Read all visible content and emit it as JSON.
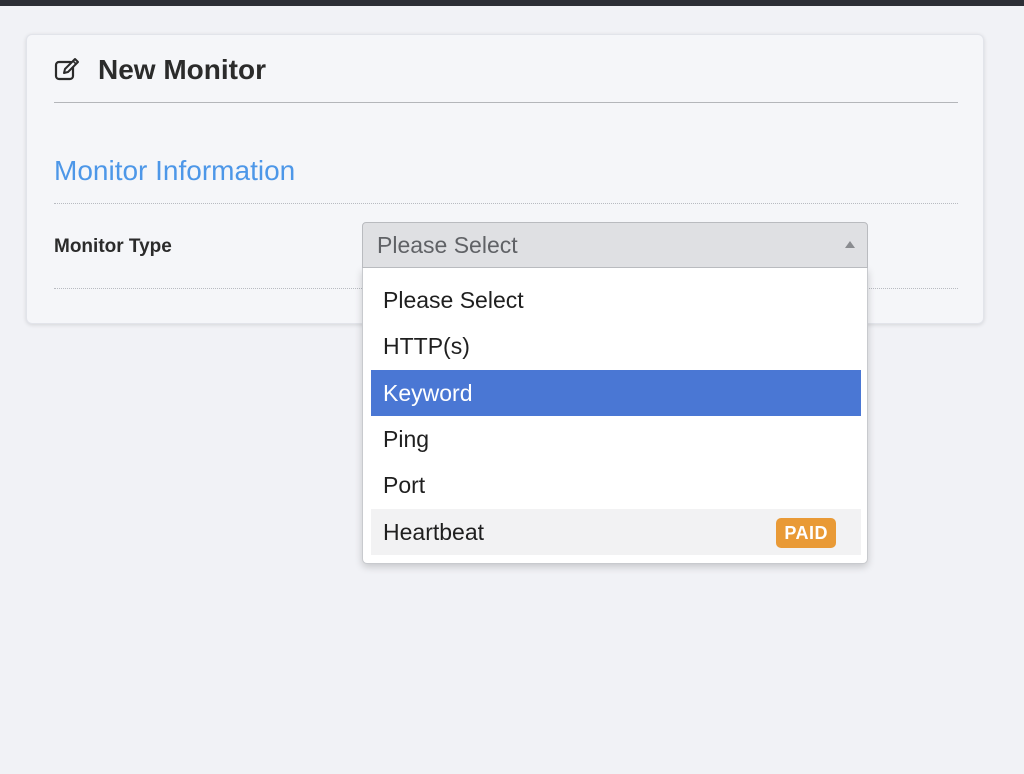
{
  "header": {
    "title": "New Monitor",
    "icon": "edit-icon"
  },
  "section": {
    "title": "Monitor Information"
  },
  "monitor_type": {
    "label": "Monitor Type",
    "selected_value": "Please Select",
    "options": [
      {
        "label": "Please Select"
      },
      {
        "label": "HTTP(s)"
      },
      {
        "label": "Keyword",
        "highlighted": true
      },
      {
        "label": "Ping"
      },
      {
        "label": "Port"
      },
      {
        "label": "Heartbeat",
        "badge": "PAID"
      }
    ]
  },
  "colors": {
    "accent": "#4d97e8",
    "highlight": "#4a77d4",
    "paid_badge": "#e99a36"
  }
}
